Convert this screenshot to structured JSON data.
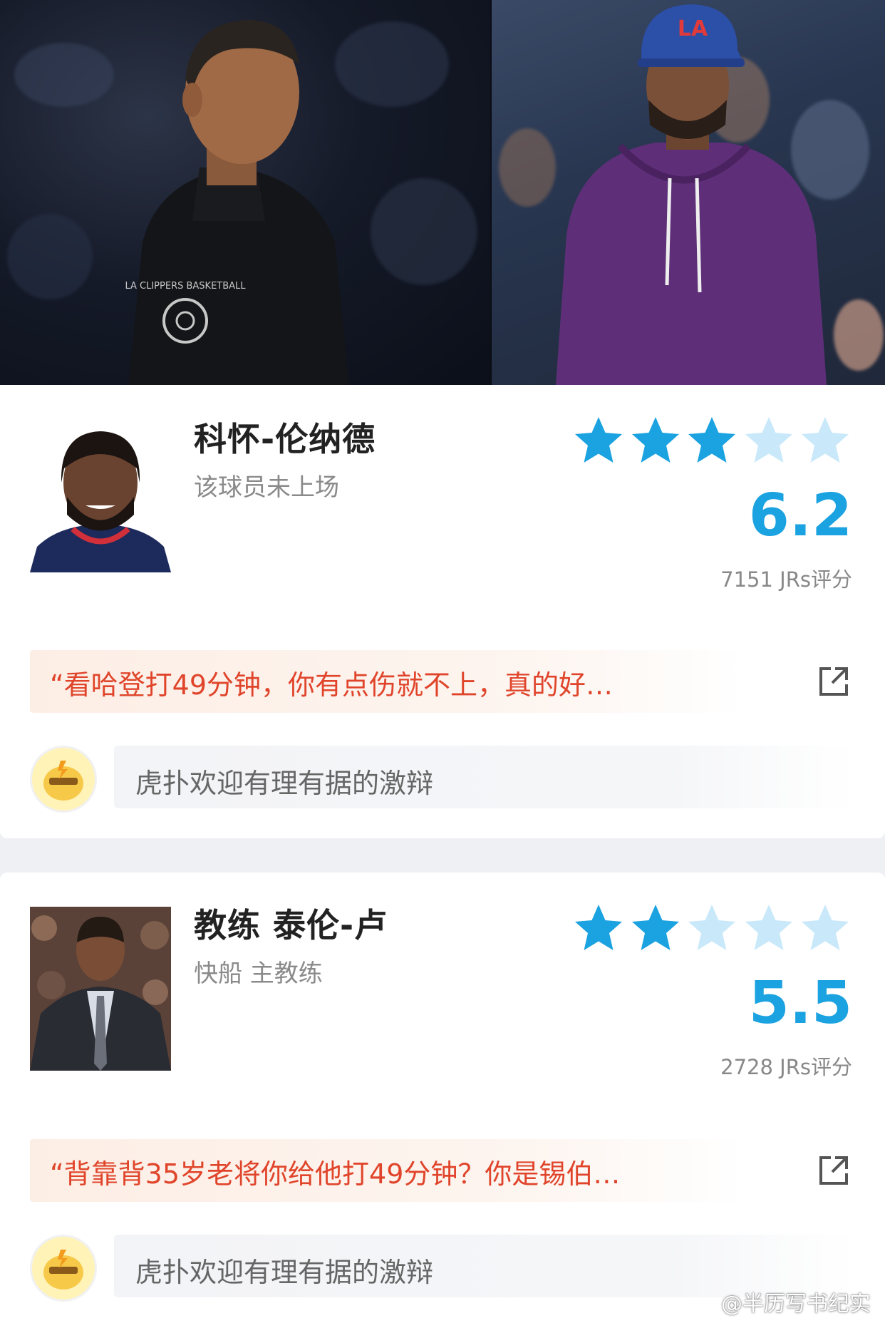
{
  "colors": {
    "accent_blue": "#1ba2e0",
    "star_empty": "#c9e9fa",
    "quote_red": "#e0452b",
    "quote_bg": "#fdeee5"
  },
  "hero": {
    "left_subject": "coach-photo",
    "right_subject": "player-photo",
    "jacket_logo_text": "LA CLIPPERS BASKETBALL",
    "cap_logo_text": "LA"
  },
  "cards": [
    {
      "name": "科怀-伦纳德",
      "subtitle": "该球员未上场",
      "rating_stars": 3,
      "max_stars": 5,
      "score": "6.2",
      "count": "7151 JRs评分",
      "quote": "“看哈登打49分钟，你有点伤就不上，真的好…",
      "comment_placeholder": "虎扑欢迎有理有据的激辩"
    },
    {
      "name": "教练 泰伦-卢",
      "subtitle": "快船 主教练",
      "rating_stars": 2,
      "max_stars": 5,
      "score": "5.5",
      "count": "2728 JRs评分",
      "quote": "“背靠背35岁老将你给他打49分钟？你是锡伯…",
      "comment_placeholder": "虎扑欢迎有理有据的激辩"
    }
  ],
  "watermark": "@半历写书纪实"
}
